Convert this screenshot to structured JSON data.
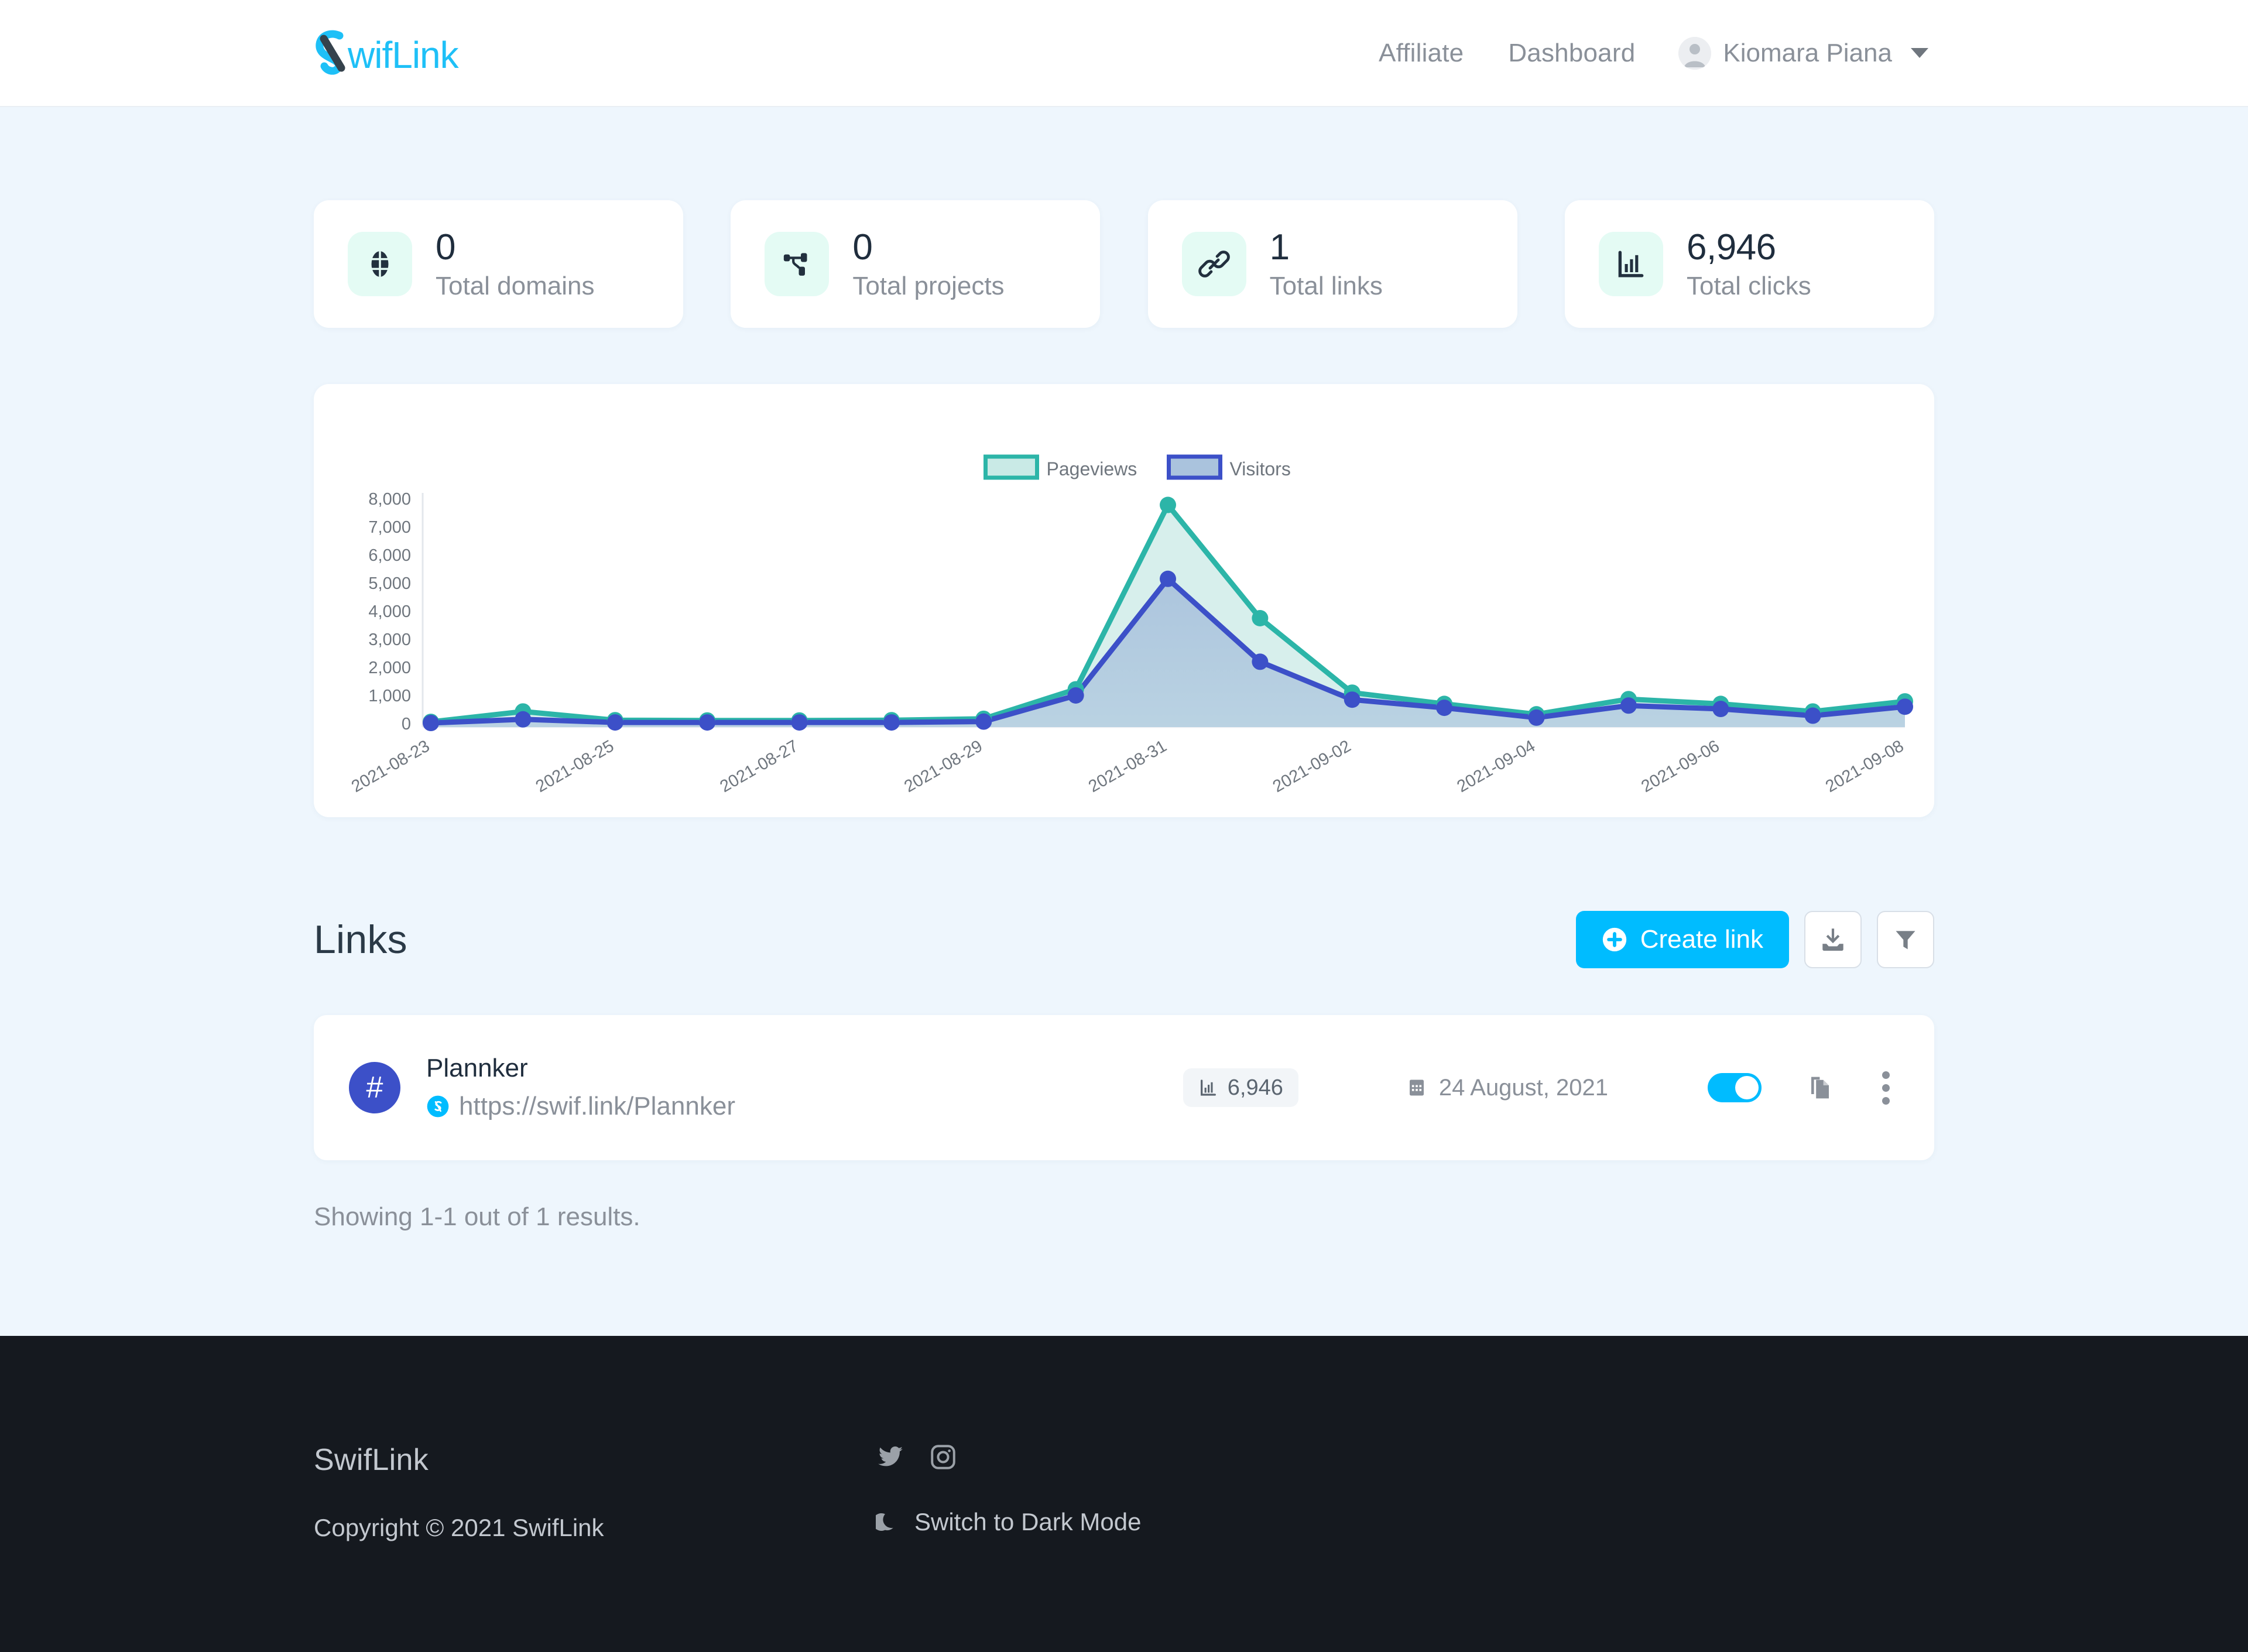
{
  "header": {
    "logo_text": "SwifLink",
    "nav": [
      {
        "label": "Affiliate"
      },
      {
        "label": "Dashboard"
      }
    ],
    "user": {
      "name": "Kiomara Piana"
    }
  },
  "stats": [
    {
      "value": "0",
      "label": "Total domains",
      "icon": "globe-icon"
    },
    {
      "value": "0",
      "label": "Total projects",
      "icon": "project-tree-icon"
    },
    {
      "value": "1",
      "label": "Total links",
      "icon": "link-chain-icon"
    },
    {
      "value": "6,946",
      "label": "Total clicks",
      "icon": "bar-chart-icon"
    }
  ],
  "chart_data": {
    "type": "area",
    "title": "",
    "xlabel": "",
    "ylabel": "",
    "ylim": [
      0,
      8000
    ],
    "yticks": [
      "0",
      "1,000",
      "2,000",
      "3,000",
      "4,000",
      "5,000",
      "6,000",
      "7,000",
      "8,000"
    ],
    "grid": false,
    "legend_position": "top-center",
    "x_tick_rotation": -30,
    "x_tick_every": 2,
    "categories": [
      "2021-08-23",
      "2021-08-24",
      "2021-08-25",
      "2021-08-26",
      "2021-08-27",
      "2021-08-28",
      "2021-08-29",
      "2021-08-30",
      "2021-08-31",
      "2021-09-01",
      "2021-09-02",
      "2021-09-03",
      "2021-09-04",
      "2021-09-05",
      "2021-09-06",
      "2021-09-07",
      "2021-09-08"
    ],
    "series": [
      {
        "name": "Pageviews",
        "color": "#2cb5a8",
        "fill": "#c9eae6",
        "values": [
          60,
          430,
          120,
          110,
          110,
          120,
          170,
          1220,
          7780,
          3750,
          1100,
          700,
          330,
          870,
          700,
          430,
          790
        ]
      },
      {
        "name": "Visitors",
        "color": "#3c50c8",
        "fill": "#aac3dd",
        "values": [
          20,
          150,
          40,
          40,
          40,
          40,
          70,
          1000,
          5150,
          2200,
          850,
          560,
          210,
          640,
          520,
          280,
          600
        ]
      }
    ]
  },
  "links_section": {
    "title": "Links",
    "create_label": "Create link",
    "download_icon": "download-icon",
    "filter_icon": "filter-icon",
    "rows": [
      {
        "avatar_char": "#",
        "title": "Plannker",
        "url": "https://swif.link/Plannker",
        "favicon": "swiflink-favicon",
        "clicks": "6,946",
        "date": "24 August, 2021",
        "enabled": true,
        "copy_icon": "copy-icon",
        "menu_icon": "kebab-menu-icon"
      }
    ],
    "showing_text": "Showing 1-1 out of 1 results."
  },
  "footer": {
    "brand": "SwifLink",
    "copyright": "Copyright © 2021 SwifLink",
    "socials": [
      {
        "name": "twitter-icon"
      },
      {
        "name": "instagram-icon"
      }
    ],
    "dark_mode_label": "Switch to Dark Mode"
  },
  "colors": {
    "accent": "#00bcff",
    "page_bg": "#eef6fd",
    "pageviews": "#2cb5a8",
    "visitors": "#3c50c8",
    "footer_bg": "#15191f"
  }
}
